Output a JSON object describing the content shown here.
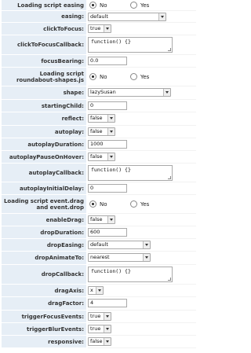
{
  "rows": [
    {
      "label": "Loading script easing",
      "type": "radio",
      "options": [
        "No",
        "Yes"
      ],
      "selected": "No"
    },
    {
      "label": "easing:",
      "type": "select",
      "value": "default"
    },
    {
      "label": "clickToFocus:",
      "type": "select",
      "value": "true"
    },
    {
      "label": "clickToFocusCallback:",
      "type": "textarea",
      "value": "function() {}"
    },
    {
      "label": "focusBearing:",
      "type": "input",
      "value": "0.0"
    },
    {
      "label": "Loading script roundabout-shapes.js",
      "type": "radio",
      "options": [
        "No",
        "Yes"
      ],
      "selected": "No"
    },
    {
      "label": "shape:",
      "type": "select",
      "value": "lazySusan"
    },
    {
      "label": "startingChild:",
      "type": "input",
      "value": "0"
    },
    {
      "label": "reflect:",
      "type": "select",
      "value": "false"
    },
    {
      "label": "autoplay:",
      "type": "select",
      "value": "false"
    },
    {
      "label": "autoplayDuration:",
      "type": "input",
      "value": "1000"
    },
    {
      "label": "autoplayPauseOnHover:",
      "type": "select",
      "value": "false"
    },
    {
      "label": "autoplayCallback:",
      "type": "textarea",
      "value": "function() {}"
    },
    {
      "label": "autoplayInitialDelay:",
      "type": "input",
      "value": "0"
    },
    {
      "label": "Loading script event.drag and event.drop",
      "type": "radio",
      "options": [
        "No",
        "Yes"
      ],
      "selected": "No"
    },
    {
      "label": "enableDrag:",
      "type": "select",
      "value": "false"
    },
    {
      "label": "dropDuration:",
      "type": "input",
      "value": "600"
    },
    {
      "label": "dropEasing:",
      "type": "select",
      "value": "default"
    },
    {
      "label": "dropAnimateTo:",
      "type": "select",
      "value": "nearest"
    },
    {
      "label": "dropCallback:",
      "type": "textarea",
      "value": "function() {}"
    },
    {
      "label": "dragAxis:",
      "type": "select",
      "value": "x"
    },
    {
      "label": "dragFactor:",
      "type": "input",
      "value": "4"
    },
    {
      "label": "triggerFocusEvents:",
      "type": "select",
      "value": "true"
    },
    {
      "label": "triggerBlurEvents:",
      "type": "select",
      "value": "true"
    },
    {
      "label": "responsive:",
      "type": "select",
      "value": "false"
    }
  ]
}
